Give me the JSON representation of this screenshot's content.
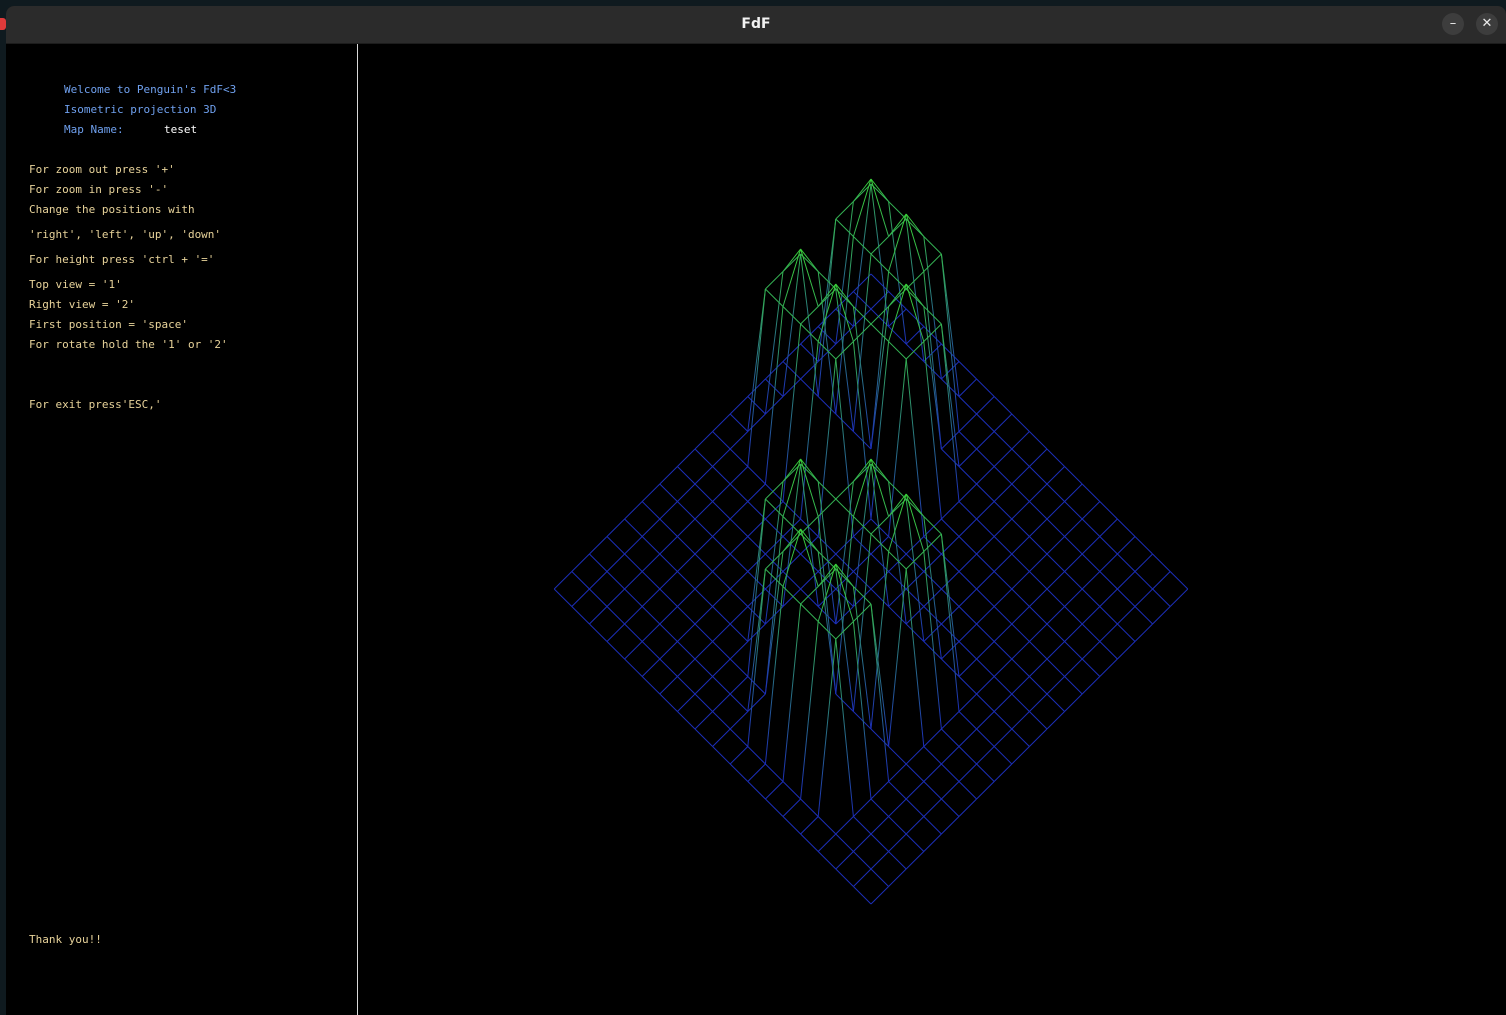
{
  "window": {
    "title": "FdF",
    "minimize_label": "–",
    "close_label": "✕"
  },
  "menu": {
    "welcome": "Welcome to Penguin's FdF<3",
    "projection": "Isometric projection 3D",
    "map_name_label": "Map Name:",
    "map_name_value": "teset",
    "zoom_out": "For zoom out press '+'",
    "zoom_in": "For zoom in press '-'",
    "change_positions": "Change the positions with",
    "directions": "'right', 'left', 'up', 'down'",
    "height": "For height press 'ctrl + '='",
    "top_view": "Top view = '1'",
    "right_view": "Right view = '2'",
    "first_position": "First position = 'space'",
    "rotate": "For rotate hold the '1' or '2'",
    "exit": "For exit press'ESC,'",
    "thanks": "Thank you!!"
  },
  "colors": {
    "menu_heading": "#6fa0ee",
    "menu_text": "#e8d39a",
    "menu_value": "#ffffff",
    "mesh_low": "#1c2fb8",
    "mesh_high": "#3ad13a",
    "background": "#000000"
  },
  "map": {
    "rows": 19,
    "cols": 19,
    "peak_height": 10,
    "peaks": [
      [
        3,
        3
      ],
      [
        3,
        5
      ],
      [
        7,
        3
      ],
      [
        7,
        5
      ],
      [
        5,
        7
      ],
      [
        11,
        11
      ],
      [
        11,
        13
      ],
      [
        13,
        9
      ],
      [
        15,
        11
      ],
      [
        15,
        13
      ]
    ]
  }
}
